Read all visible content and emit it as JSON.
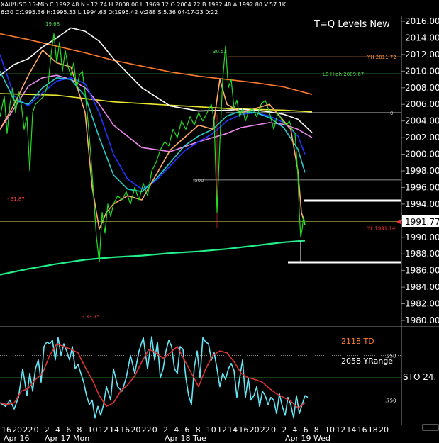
{
  "header": {
    "line1": "XAU/USD 15-Min C:1992.48 N:- 12.74 H:2008.06 L:1969.12 O:2004.72 B:1992.48 A:1992.80 V:57.1K",
    "line2": "6:30 C:1995.36 H:1995.53 L:1994.63 O:1995.42 V:288 S:5.36 04-17-23 0:22"
  },
  "chart_data": [
    {
      "type": "line",
      "title": "T=Q Levels New",
      "symbol": "XAU/USD",
      "timeframe": "15-Min",
      "ylim": [
        1980,
        2016
      ],
      "y_ticks": [
        "2016.00",
        "2014.00",
        "2012.00",
        "2010.00",
        "2008.00",
        "2006.00",
        "2004.00",
        "2002.00",
        "2000.00",
        "1998.00",
        "1996.00",
        "1994.00",
        "1992.00",
        "1990.00",
        "1988.00",
        "1986.00",
        "1984.00",
        "1982.00",
        "1980.00"
      ],
      "current_price": "1991.77",
      "x_ticks": [
        "16",
        "20",
        "22",
        "0",
        "2",
        "4",
        "6",
        "8",
        "10",
        "12",
        "14",
        "16",
        "20",
        "22",
        "0",
        "2",
        "4",
        "6",
        "8",
        "10",
        "12",
        "14",
        "16",
        "20",
        "22",
        "0",
        "2",
        "4",
        "6",
        "8",
        "10",
        "12",
        "14",
        "16",
        "18",
        "20"
      ],
      "date_labels": [
        "Apr 16",
        "Apr 17 Mon",
        "Apr 18 Tue",
        "Apr 19 Wed"
      ],
      "level_lines": [
        {
          "label": "YH 2011.72",
          "value": 2011.72,
          "color": "#ff9a4a"
        },
        {
          "label": "LB High 2009.67",
          "value": 2009.67,
          "color": "#4fd84f"
        },
        {
          "label": "0",
          "value": 2005.0,
          "color": "#bbbbbb"
        },
        {
          "label": ".500",
          "value": 1996.9,
          "color": "#bbbbbb"
        },
        {
          "label": "YL 1991.14",
          "value": 1991.14,
          "color": "#ff3030"
        }
      ],
      "annotations": [
        "19.68",
        "30.52",
        "- 31.87",
        "- 33.75"
      ],
      "series": [
        {
          "color": "#ff7a30",
          "x": [
            0,
            40,
            80,
            120,
            160,
            200,
            240,
            280,
            320,
            360,
            400,
            440
          ],
          "y": [
            2014.5,
            2013.8,
            2013.0,
            2012.2,
            2011.3,
            2010.6,
            2009.9,
            2009.4,
            2009.0,
            2008.6,
            2008.1,
            2007.2
          ]
        },
        {
          "color": "#e8e830",
          "x": [
            0,
            40,
            80,
            120,
            160,
            200,
            240,
            280,
            320,
            360,
            400,
            440
          ],
          "y": [
            2007.3,
            2007.2,
            2007.1,
            2006.7,
            2006.3,
            2006.1,
            2005.9,
            2005.7,
            2005.5,
            2005.4,
            2005.3,
            2005.1
          ]
        },
        {
          "color": "#ffffff",
          "x": [
            0,
            20,
            40,
            60,
            80,
            100,
            120,
            140,
            160,
            200,
            240,
            280,
            320,
            340,
            360,
            380,
            400,
            420,
            440
          ],
          "y": [
            2009.5,
            2010.8,
            2011.5,
            2012.9,
            2014.0,
            2015.2,
            2014.8,
            2013.6,
            2011.5,
            2008.0,
            2005.8,
            2005.2,
            2005.3,
            2005.4,
            2005.3,
            2005.1,
            2004.8,
            2004.2,
            2002.6
          ]
        },
        {
          "color": "#ee88ee",
          "x": [
            0,
            20,
            40,
            60,
            80,
            100,
            120,
            140,
            160,
            200,
            240,
            280,
            320,
            340,
            360,
            380,
            400,
            420,
            440
          ],
          "y": [
            2003.0,
            2005.5,
            2008.2,
            2009.2,
            2009.5,
            2009.0,
            2008.0,
            2006.0,
            2003.5,
            2000.8,
            2000.3,
            2001.5,
            2002.5,
            2003.2,
            2003.5,
            2003.8,
            2003.6,
            2003.0,
            2002.0
          ]
        },
        {
          "color": "#2233ff",
          "x": [
            0,
            20,
            40,
            60,
            80,
            100,
            120,
            140,
            160,
            180,
            200,
            220,
            240,
            260,
            280,
            300,
            320,
            340,
            360,
            380,
            400,
            420,
            430
          ],
          "y": [
            2012.0,
            2007.0,
            2005.8,
            2007.4,
            2008.8,
            2009.2,
            2008.5,
            2005.0,
            2000.0,
            1997.0,
            1995.8,
            1996.8,
            1998.6,
            2000.4,
            2001.5,
            2002.5,
            2004.0,
            2004.8,
            2005.0,
            2004.6,
            2003.8,
            2002.2,
            2000.0
          ]
        },
        {
          "color": "#22cccc",
          "x": [
            0,
            20,
            40,
            60,
            80,
            100,
            120,
            140,
            160,
            180,
            200,
            220,
            240,
            260,
            280,
            300,
            320,
            340,
            360,
            380,
            400,
            420,
            430
          ],
          "y": [
            2010.0,
            2006.5,
            2006.0,
            2008.0,
            2009.2,
            2009.0,
            2007.0,
            2002.0,
            1997.5,
            1995.8,
            1995.5,
            1997.0,
            1999.0,
            2001.0,
            2002.2,
            2003.0,
            2004.6,
            2005.2,
            2005.0,
            2004.4,
            2003.2,
            2000.6,
            1997.8
          ]
        },
        {
          "color": "#ffaa66",
          "x": [
            0,
            20,
            40,
            60,
            80,
            100,
            120,
            130,
            140,
            150,
            160,
            180,
            200,
            220,
            240,
            260,
            280,
            300,
            310,
            320,
            340,
            360,
            380,
            400,
            410,
            420,
            425,
            430
          ],
          "y": [
            2003.0,
            2006.0,
            2009.5,
            2012.5,
            2011.0,
            2010.5,
            2005.0,
            1996.0,
            1991.0,
            1993.0,
            1994.0,
            1995.0,
            1994.5,
            1997.5,
            2000.5,
            2002.0,
            2003.5,
            2003.0,
            2009.0,
            2006.0,
            2005.0,
            2005.5,
            2006.0,
            2004.0,
            2003.0,
            1998.0,
            1993.0,
            1991.5
          ]
        },
        {
          "color": "#22ee88",
          "x": [
            0,
            40,
            80,
            120,
            160,
            200,
            240,
            280,
            320,
            360,
            400,
            430
          ],
          "y": [
            1985.5,
            1986.2,
            1986.8,
            1987.3,
            1987.6,
            1987.8,
            1988.1,
            1988.3,
            1988.6,
            1989.0,
            1989.4,
            1989.6
          ]
        },
        {
          "color": "#22dd22",
          "x": [
            0,
            6,
            10,
            14,
            18,
            22,
            26,
            30,
            34,
            38,
            42,
            46,
            50,
            56,
            62,
            68,
            72,
            76,
            80,
            84,
            88,
            92,
            96,
            100,
            104,
            108,
            112,
            116,
            120,
            124,
            128,
            132,
            136,
            140,
            144,
            148,
            152,
            156,
            160,
            166,
            172,
            178,
            184,
            190,
            196,
            202,
            208,
            214,
            220,
            226,
            232,
            238,
            244,
            250,
            256,
            262,
            268,
            274,
            280,
            286,
            292,
            298,
            302,
            306,
            310,
            314,
            318,
            322,
            326,
            330,
            334,
            338,
            342,
            346,
            350,
            356,
            362,
            368,
            374,
            380,
            386,
            392,
            398,
            404,
            408,
            412,
            416,
            418,
            420,
            422,
            424,
            426,
            428,
            430
          ],
          "y": [
            2004.5,
            2007.0,
            2002.5,
            2006.0,
            2008.0,
            2005.0,
            2007.5,
            2006.0,
            2003.0,
            2004.5,
            1998.0,
            2005.0,
            2006.0,
            2006.5,
            2007.0,
            2008.5,
            2012.0,
            2014.5,
            2011.0,
            2013.5,
            2010.0,
            2012.5,
            2010.5,
            2009.5,
            2011.0,
            2008.0,
            2009.5,
            2010.0,
            2007.5,
            2004.0,
            2000.0,
            1995.0,
            1990.0,
            1987.0,
            1993.0,
            1990.5,
            1994.0,
            1992.5,
            1994.0,
            1995.0,
            1994.5,
            1995.5,
            1994.0,
            1996.0,
            1994.5,
            1996.5,
            1995.0,
            1998.0,
            1999.0,
            2000.5,
            2001.5,
            2001.0,
            2003.0,
            2002.0,
            2004.0,
            2003.0,
            2004.5,
            2003.5,
            2005.0,
            2004.0,
            2005.0,
            2006.0,
            2004.0,
            1993.0,
            2001.5,
            2009.0,
            2013.0,
            2008.0,
            2009.0,
            2005.5,
            2006.5,
            2004.5,
            2005.5,
            2004.0,
            2005.0,
            2005.5,
            2004.5,
            2006.0,
            2006.5,
            2005.0,
            2003.0,
            2005.0,
            2004.0,
            2003.5,
            2004.0,
            2003.0,
            2002.5,
            2000.0,
            1997.5,
            1993.0,
            1990.0,
            1991.0,
            1992.5,
            1991.5
          ]
        }
      ]
    },
    {
      "type": "line",
      "ylim": [
        0,
        100
      ],
      "levels": [
        ".250",
        ".750"
      ],
      "labels": [
        {
          "text": "2118 TD",
          "color": "#ff7a30"
        },
        {
          "text": "2058 YRange",
          "color": "#ffffff"
        },
        {
          "text": "STO  24.",
          "color": "#ffffff"
        }
      ],
      "series": [
        {
          "color": "#66e6f5",
          "x": [
            0,
            8,
            14,
            20,
            26,
            32,
            38,
            42,
            46,
            50,
            54,
            58,
            62,
            66,
            70,
            74,
            78,
            82,
            86,
            90,
            94,
            98,
            102,
            106,
            110,
            114,
            118,
            122,
            126,
            130,
            134,
            138,
            142,
            146,
            150,
            156,
            160,
            166,
            172,
            178,
            184,
            190,
            196,
            202,
            208,
            214,
            218,
            222,
            226,
            230,
            234,
            238,
            242,
            246,
            250,
            254,
            258,
            262,
            266,
            270,
            274,
            278,
            282,
            286,
            290,
            294,
            298,
            302,
            306,
            310,
            314,
            318,
            322,
            326,
            330,
            334,
            338,
            342,
            346,
            350,
            354,
            358,
            362,
            366,
            370,
            374,
            378,
            382,
            386,
            390,
            394,
            398,
            402,
            406,
            410,
            414,
            418,
            422,
            426,
            430,
            434
          ],
          "y": [
            22,
            18,
            25,
            15,
            28,
            60,
            30,
            55,
            35,
            60,
            70,
            45,
            85,
            90,
            88,
            92,
            70,
            95,
            75,
            88,
            80,
            70,
            85,
            60,
            65,
            55,
            45,
            30,
            20,
            25,
            5,
            18,
            8,
            20,
            40,
            25,
            60,
            40,
            35,
            50,
            75,
            55,
            80,
            95,
            60,
            96,
            70,
            90,
            50,
            60,
            80,
            92,
            85,
            60,
            55,
            85,
            82,
            50,
            30,
            20,
            62,
            80,
            50,
            95,
            90,
            88,
            70,
            78,
            60,
            40,
            55,
            48,
            60,
            66,
            58,
            28,
            50,
            70,
            28,
            50,
            25,
            30,
            40,
            18,
            35,
            30,
            20,
            28,
            25,
            10,
            32,
            18,
            8,
            28,
            20,
            5,
            30,
            10,
            20,
            30,
            28
          ]
        },
        {
          "color": "#dd3333",
          "x": [
            0,
            10,
            20,
            30,
            40,
            50,
            60,
            70,
            80,
            90,
            100,
            110,
            120,
            130,
            140,
            150,
            160,
            170,
            180,
            190,
            200,
            210,
            220,
            230,
            240,
            250,
            260,
            270,
            280,
            290,
            300,
            310,
            320,
            330,
            340,
            350,
            360,
            370,
            380,
            390,
            400,
            410,
            420,
            430
          ],
          "y": [
            22,
            20,
            22,
            35,
            38,
            48,
            55,
            75,
            88,
            85,
            82,
            78,
            62,
            48,
            30,
            18,
            22,
            35,
            42,
            52,
            68,
            82,
            78,
            72,
            78,
            85,
            70,
            55,
            40,
            60,
            75,
            80,
            78,
            68,
            55,
            50,
            48,
            45,
            38,
            32,
            28,
            24,
            16,
            22
          ]
        }
      ]
    }
  ]
}
